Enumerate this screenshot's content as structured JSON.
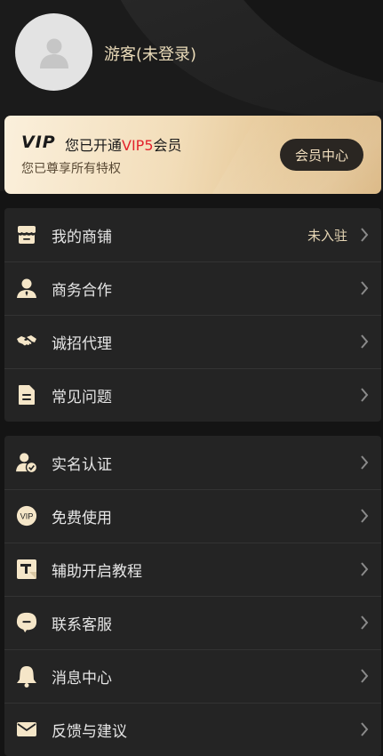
{
  "profile": {
    "name": "游客(未登录)"
  },
  "vip": {
    "logo": "VIP",
    "title_prefix": "您已开通",
    "title_highlight": "VIP5",
    "title_suffix": "会员",
    "subtitle": "您已尊享所有特权",
    "center_button": "会员中心",
    "highlight_color": "#e3222d"
  },
  "menu_group1": [
    {
      "label": "我的商铺",
      "extra": "未入驻",
      "icon": "store-icon"
    },
    {
      "label": "商务合作",
      "icon": "business-person-icon"
    },
    {
      "label": "诚招代理",
      "icon": "handshake-icon"
    },
    {
      "label": "常见问题",
      "icon": "document-icon"
    }
  ],
  "menu_group2": [
    {
      "label": "实名认证",
      "icon": "verified-user-icon"
    },
    {
      "label": "免费使用",
      "icon_text": "VIP",
      "icon": "vip-badge-icon"
    },
    {
      "label": "辅助开启教程",
      "icon": "tutorial-icon"
    },
    {
      "label": "联系客服",
      "icon": "chat-bubble-icon"
    },
    {
      "label": "消息中心",
      "icon": "bell-icon"
    },
    {
      "label": "反馈与建议",
      "icon": "mail-icon"
    }
  ],
  "colors": {
    "accent_gold": "#eadbb9",
    "icon_cream": "#f5e6c8",
    "background": "#141414"
  }
}
